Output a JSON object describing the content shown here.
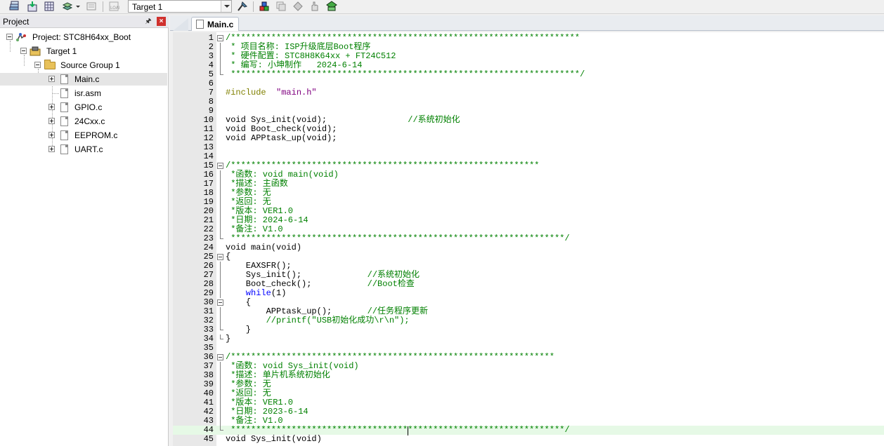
{
  "toolbar": {
    "target_value": "Target 1"
  },
  "project_panel": {
    "title": "Project",
    "close": "×",
    "tree": [
      {
        "label": "Project: STC8H64xx_Boot",
        "level": 0
      },
      {
        "label": "Target 1",
        "level": 1
      },
      {
        "label": "Source Group 1",
        "level": 2
      },
      {
        "label": "Main.c",
        "level": 3,
        "expandable": true,
        "selected": true
      },
      {
        "label": "isr.asm",
        "level": 3,
        "expandable": false
      },
      {
        "label": "GPIO.c",
        "level": 3,
        "expandable": true
      },
      {
        "label": "24Cxx.c",
        "level": 3,
        "expandable": true
      },
      {
        "label": "EEPROM.c",
        "level": 3,
        "expandable": true
      },
      {
        "label": "UART.c",
        "level": 3,
        "expandable": true
      }
    ]
  },
  "editor": {
    "active_tab": "Main.c",
    "lines": [
      {
        "n": "1",
        "fold": "start",
        "segs": [
          [
            "c-comment",
            "/*********************************************************************"
          ]
        ]
      },
      {
        "n": "2",
        "fold": "bar",
        "segs": [
          [
            "c-comment",
            " * 项目名称: ISP升级底层Boot程序"
          ]
        ]
      },
      {
        "n": "3",
        "fold": "bar",
        "segs": [
          [
            "c-comment",
            " * 硬件配置: STC8H8K64xx + FT24C512"
          ]
        ]
      },
      {
        "n": "4",
        "fold": "bar",
        "segs": [
          [
            "c-comment",
            " * 编写: 小坤制作   2024-6-14"
          ]
        ]
      },
      {
        "n": "5",
        "fold": "end",
        "segs": [
          [
            "c-comment",
            " *********************************************************************/"
          ]
        ]
      },
      {
        "n": "6",
        "fold": "",
        "segs": []
      },
      {
        "n": "7",
        "fold": "",
        "segs": [
          [
            "c-pp",
            "#include  "
          ],
          [
            "c-str",
            "\"main.h\""
          ]
        ]
      },
      {
        "n": "8",
        "fold": "",
        "segs": []
      },
      {
        "n": "9",
        "fold": "",
        "segs": []
      },
      {
        "n": "10",
        "fold": "",
        "segs": [
          [
            "c-def",
            "void Sys_init(void);                "
          ],
          [
            "c-comment",
            "//系统初始化"
          ]
        ]
      },
      {
        "n": "11",
        "fold": "",
        "segs": [
          [
            "c-def",
            "void Boot_check(void);"
          ]
        ]
      },
      {
        "n": "12",
        "fold": "",
        "segs": [
          [
            "c-def",
            "void APPtask_up(void);"
          ]
        ]
      },
      {
        "n": "13",
        "fold": "",
        "segs": []
      },
      {
        "n": "14",
        "fold": "",
        "segs": []
      },
      {
        "n": "15",
        "fold": "start",
        "segs": [
          [
            "c-comment",
            "/*************************************************************"
          ]
        ]
      },
      {
        "n": "16",
        "fold": "bar",
        "segs": [
          [
            "c-comment",
            " *函数: void main(void)"
          ]
        ]
      },
      {
        "n": "17",
        "fold": "bar",
        "segs": [
          [
            "c-comment",
            " *描述: 主函数"
          ]
        ]
      },
      {
        "n": "18",
        "fold": "bar",
        "segs": [
          [
            "c-comment",
            " *参数: 无"
          ]
        ]
      },
      {
        "n": "19",
        "fold": "bar",
        "segs": [
          [
            "c-comment",
            " *返回: 无"
          ]
        ]
      },
      {
        "n": "20",
        "fold": "bar",
        "segs": [
          [
            "c-comment",
            " *版本: VER1.0"
          ]
        ]
      },
      {
        "n": "21",
        "fold": "bar",
        "segs": [
          [
            "c-comment",
            " *日期: 2024-6-14"
          ]
        ]
      },
      {
        "n": "22",
        "fold": "bar",
        "segs": [
          [
            "c-comment",
            " *备注: V1.0"
          ]
        ]
      },
      {
        "n": "23",
        "fold": "end",
        "segs": [
          [
            "c-comment",
            " ******************************************************************/"
          ]
        ]
      },
      {
        "n": "24",
        "fold": "",
        "segs": [
          [
            "c-def",
            "void main(void)"
          ]
        ]
      },
      {
        "n": "25",
        "fold": "start",
        "segs": [
          [
            "c-def",
            "{"
          ]
        ]
      },
      {
        "n": "26",
        "fold": "bar",
        "segs": [
          [
            "c-def",
            "    EAXSFR();"
          ]
        ]
      },
      {
        "n": "27",
        "fold": "bar",
        "segs": [
          [
            "c-def",
            "    Sys_init();             "
          ],
          [
            "c-comment",
            "//系统初始化"
          ]
        ]
      },
      {
        "n": "28",
        "fold": "bar",
        "segs": [
          [
            "c-def",
            "    Boot_check();           "
          ],
          [
            "c-comment",
            "//Boot检查"
          ]
        ]
      },
      {
        "n": "29",
        "fold": "bar",
        "segs": [
          [
            "c-kw",
            "    while"
          ],
          [
            "c-def",
            "(1)"
          ]
        ]
      },
      {
        "n": "30",
        "fold": "start",
        "segs": [
          [
            "c-def",
            "    {"
          ]
        ]
      },
      {
        "n": "31",
        "fold": "bar",
        "segs": [
          [
            "c-def",
            "        APPtask_up();       "
          ],
          [
            "c-comment",
            "//任务程序更新"
          ]
        ]
      },
      {
        "n": "32",
        "fold": "bar",
        "segs": [
          [
            "c-comment",
            "        //printf(\"USB初始化成功\\r\\n\");"
          ]
        ]
      },
      {
        "n": "33",
        "fold": "end",
        "segs": [
          [
            "c-def",
            "    }"
          ]
        ]
      },
      {
        "n": "34",
        "fold": "end",
        "segs": [
          [
            "c-def",
            "}"
          ]
        ]
      },
      {
        "n": "35",
        "fold": "",
        "segs": []
      },
      {
        "n": "36",
        "fold": "start",
        "segs": [
          [
            "c-comment",
            "/****************************************************************"
          ]
        ]
      },
      {
        "n": "37",
        "fold": "bar",
        "segs": [
          [
            "c-comment",
            " *函数: void Sys_init(void)"
          ]
        ]
      },
      {
        "n": "38",
        "fold": "bar",
        "segs": [
          [
            "c-comment",
            " *描述: 单片机系统初始化"
          ]
        ]
      },
      {
        "n": "39",
        "fold": "bar",
        "segs": [
          [
            "c-comment",
            " *参数: 无"
          ]
        ]
      },
      {
        "n": "40",
        "fold": "bar",
        "segs": [
          [
            "c-comment",
            " *返回: 无"
          ]
        ]
      },
      {
        "n": "41",
        "fold": "bar",
        "segs": [
          [
            "c-comment",
            " *版本: VER1.0"
          ]
        ]
      },
      {
        "n": "42",
        "fold": "bar",
        "segs": [
          [
            "c-comment",
            " *日期: 2023-6-14"
          ]
        ]
      },
      {
        "n": "43",
        "fold": "bar",
        "segs": [
          [
            "c-comment",
            " *备注: V1.0"
          ]
        ]
      },
      {
        "n": "44",
        "fold": "end",
        "hl": true,
        "segs": [
          [
            "c-comment",
            " ******************************************************************/"
          ]
        ]
      },
      {
        "n": "45",
        "fold": "",
        "segs": [
          [
            "c-def",
            "void Sys_init(void)"
          ]
        ]
      }
    ]
  }
}
